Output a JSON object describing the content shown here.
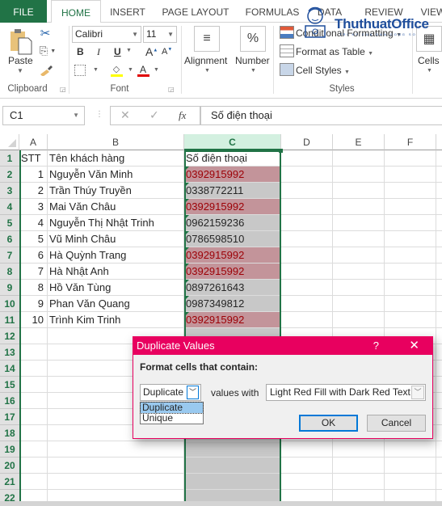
{
  "ribbon_tabs": [
    "FILE",
    "HOME",
    "INSERT",
    "PAGE LAYOUT",
    "FORMULAS",
    "DATA",
    "REVIEW",
    "VIEW"
  ],
  "active_tab": "HOME",
  "clipboard": {
    "paste_label": "Paste",
    "group_label": "Clipboard"
  },
  "font": {
    "name": "Calibri",
    "size": "11",
    "group_label": "Font",
    "bold": "B",
    "italic": "I",
    "underline": "U",
    "highlight_color": "#ffff00",
    "font_color": "#e00000"
  },
  "alignment": {
    "label": "Alignment",
    "icon": "≡"
  },
  "number": {
    "label": "Number",
    "icon": "%"
  },
  "styles": {
    "conditional_formatting": "Conditional Formatting",
    "format_as_table": "Format as Table",
    "cell_styles": "Cell Styles",
    "group_label": "Styles"
  },
  "cells": {
    "label": "Cells"
  },
  "watermark": {
    "text": "ThuthuatOffice",
    "sub": "TRI KY CUA DAN CONG SO"
  },
  "formula_bar": {
    "name_box": "C1",
    "cancel": "✕",
    "enter": "✓",
    "fx": "fx",
    "value": "Số điện thoại"
  },
  "columns": [
    "A",
    "B",
    "C",
    "D",
    "E",
    "F"
  ],
  "selected_column": "C",
  "rows": [
    {
      "n": "1",
      "a": "STT",
      "b": "Tên khách hàng",
      "c": "Số điện thoại",
      "dup": false,
      "header": true
    },
    {
      "n": "2",
      "a": "1",
      "b": "Nguyễn Văn Minh",
      "c": "0392915992",
      "dup": true
    },
    {
      "n": "3",
      "a": "2",
      "b": "Trần Thúy Truyền",
      "c": "0338772211",
      "dup": false
    },
    {
      "n": "4",
      "a": "3",
      "b": "Mai Văn Châu",
      "c": "0392915992",
      "dup": true
    },
    {
      "n": "5",
      "a": "4",
      "b": "Nguyễn Thị Nhật Trinh",
      "c": "0962159236",
      "dup": false
    },
    {
      "n": "6",
      "a": "5",
      "b": "Vũ Minh Châu",
      "c": "0786598510",
      "dup": false
    },
    {
      "n": "7",
      "a": "6",
      "b": "Hà Quỳnh Trang",
      "c": "0392915992",
      "dup": true
    },
    {
      "n": "8",
      "a": "7",
      "b": "Hà Nhật Anh",
      "c": "0392915992",
      "dup": true
    },
    {
      "n": "9",
      "a": "8",
      "b": "Hồ Văn Tùng",
      "c": "0897261643",
      "dup": false
    },
    {
      "n": "10",
      "a": "9",
      "b": "Phan Văn Quang",
      "c": "0987349812",
      "dup": false
    },
    {
      "n": "11",
      "a": "10",
      "b": "Trình Kim Trinh",
      "c": "0392915992",
      "dup": true
    },
    {
      "n": "12"
    },
    {
      "n": "13"
    },
    {
      "n": "14"
    },
    {
      "n": "15"
    },
    {
      "n": "16"
    },
    {
      "n": "17"
    },
    {
      "n": "18"
    },
    {
      "n": "19"
    },
    {
      "n": "20"
    },
    {
      "n": "21"
    },
    {
      "n": "22"
    }
  ],
  "dialog": {
    "title": "Duplicate Values",
    "help": "?",
    "close": "✕",
    "prompt": "Format cells that contain:",
    "type_selected": "Duplicate",
    "type_options": [
      "Duplicate",
      "Unique"
    ],
    "values_with": "values with",
    "format_selected": "Light Red Fill with Dark Red Text",
    "ok": "OK",
    "cancel": "Cancel",
    "accent": "#e8005f"
  },
  "colors": {
    "excel_green": "#217346",
    "dup_fill": "#c3949a",
    "dup_text": "#9c0006"
  }
}
